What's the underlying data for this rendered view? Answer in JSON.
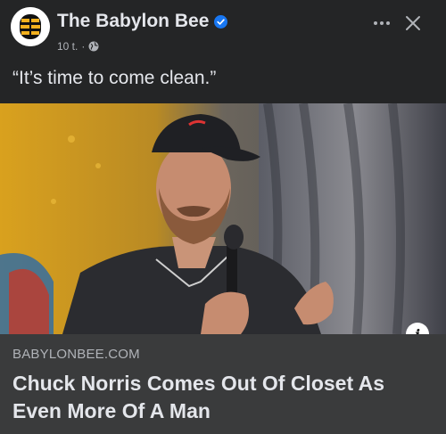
{
  "post": {
    "page_name": "The Babylon Bee",
    "verified_icon": "verified-badge-icon",
    "timestamp": "10 t.",
    "separator": "·",
    "audience_icon": "globe-icon",
    "caption": "“It’s time to come clean.”"
  },
  "actions": {
    "more_icon": "more-options-icon",
    "close_icon": "close-icon"
  },
  "link_preview": {
    "domain": "BABYLONBEE.COM",
    "headline": "Chuck Norris Comes Out Of Closet As Even More Of A Man",
    "info_icon": "info-icon",
    "info_glyph": "i"
  },
  "colors": {
    "background": "#242526",
    "preview_background": "#3a3b3c",
    "verified_blue": "#1877f2",
    "primary_text": "#e4e6eb",
    "secondary_text": "#b0b3b8"
  }
}
